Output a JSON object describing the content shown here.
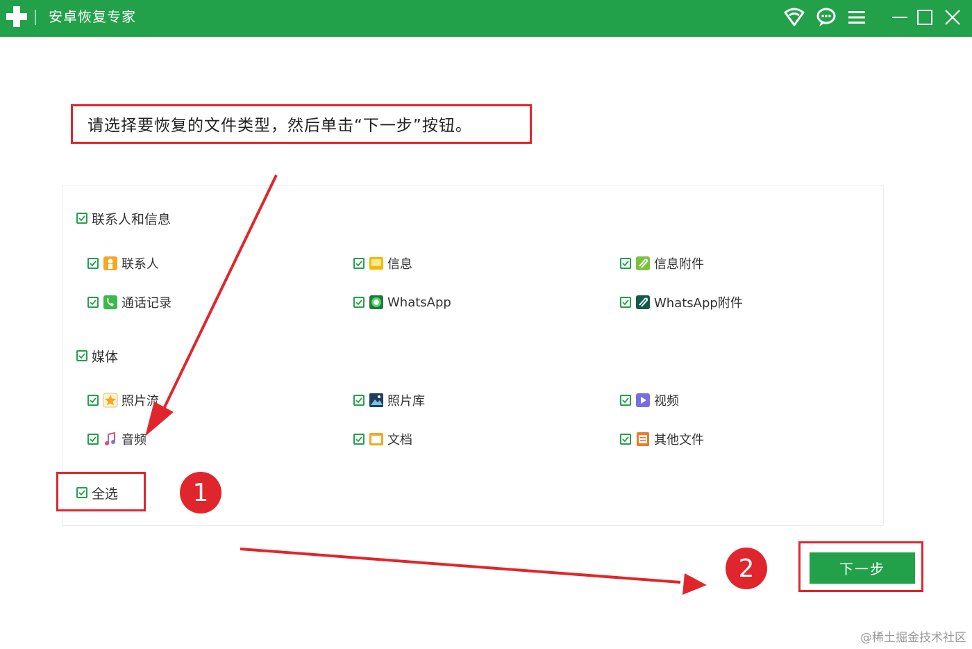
{
  "app": {
    "title": "安卓恢复专家"
  },
  "instruction": "请选择要恢复的文件类型，然后单击“下一步”按钮。",
  "groups": [
    {
      "label": "联系人和信息",
      "items": [
        {
          "label": "联系人",
          "icon": "contacts-icon"
        },
        {
          "label": "信息",
          "icon": "message-icon"
        },
        {
          "label": "信息附件",
          "icon": "message-attachment-icon"
        },
        {
          "label": "通话记录",
          "icon": "call-log-icon"
        },
        {
          "label": "WhatsApp",
          "icon": "whatsapp-icon"
        },
        {
          "label": "WhatsApp附件",
          "icon": "whatsapp-attachment-icon"
        }
      ]
    },
    {
      "label": "媒体",
      "items": [
        {
          "label": "照片流",
          "icon": "photo-stream-icon"
        },
        {
          "label": "照片库",
          "icon": "photo-library-icon"
        },
        {
          "label": "视频",
          "icon": "video-icon"
        },
        {
          "label": "音频",
          "icon": "audio-icon"
        },
        {
          "label": "文档",
          "icon": "document-icon"
        },
        {
          "label": "其他文件",
          "icon": "other-files-icon"
        }
      ]
    }
  ],
  "select_all": {
    "label": "全选",
    "checked": true
  },
  "next_button": {
    "label": "下一步"
  },
  "annotations": {
    "step1": "1",
    "step2": "2"
  },
  "watermark": "@稀土掘金技术社区",
  "colors": {
    "brand_green": "#22a14a",
    "annotation_red": "#e0262c"
  }
}
